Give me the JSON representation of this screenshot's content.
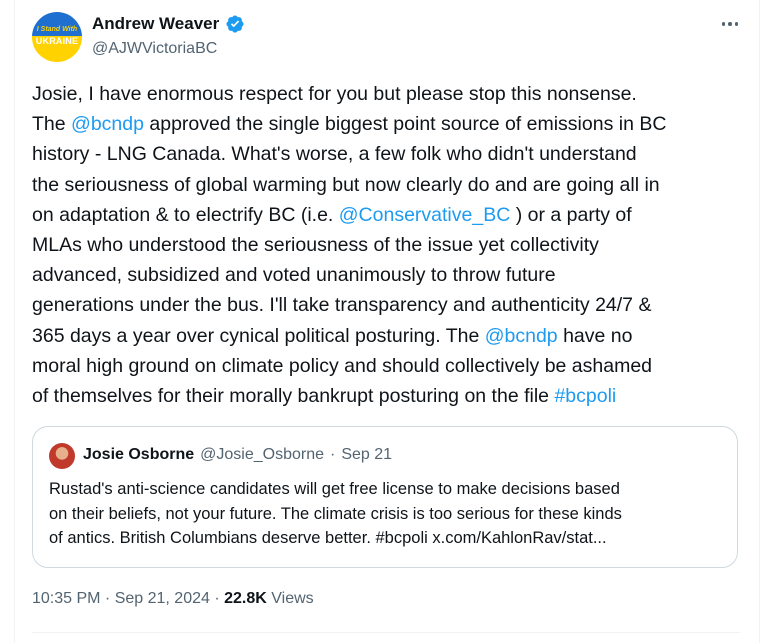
{
  "author": {
    "name": "Andrew Weaver",
    "handle": "@AJWVictoriaBC",
    "avatar_text_top": "I Stand With",
    "avatar_text_bottom": "UKRAINE",
    "verified_color": "#1d9bf0"
  },
  "tweet": {
    "lines": [
      [
        {
          "t": "Josie, I have enormous respect for you but please stop this nonsense."
        }
      ],
      [
        {
          "t": "The "
        },
        {
          "t": "@bcndp",
          "link": true
        },
        {
          "t": " approved the single biggest point source of emissions in BC"
        }
      ],
      [
        {
          "t": "history - LNG Canada. What's worse, a few folk who didn't understand"
        }
      ],
      [
        {
          "t": "the seriousness of global warming but now clearly do and are going all in"
        }
      ],
      [
        {
          "t": "on adaptation & to electrify BC (i.e. "
        },
        {
          "t": "@Conservative_BC",
          "link": true
        },
        {
          "t": " ) or a party of"
        }
      ],
      [
        {
          "t": "MLAs who understood the seriousness of the issue yet collectivity"
        }
      ],
      [
        {
          "t": "advanced, subsidized and voted unanimously to throw future"
        }
      ],
      [
        {
          "t": "generations under the bus. I'll take transparency and authenticity 24/7 &"
        }
      ],
      [
        {
          "t": "365 days a year over cynical political posturing. The "
        },
        {
          "t": "@bcndp",
          "link": true
        },
        {
          "t": " have no"
        }
      ],
      [
        {
          "t": "moral high ground on climate policy and should collectively be ashamed"
        }
      ],
      [
        {
          "t": "of themselves for their morally bankrupt posturing on the file "
        },
        {
          "t": "#bcpoli",
          "link": true
        }
      ]
    ]
  },
  "quote": {
    "name": "Josie Osborne",
    "handle": "@Josie_Osborne",
    "separator": "·",
    "date": "Sep 21",
    "lines": [
      "Rustad's anti-science candidates will get free license to make decisions based",
      "on their beliefs, not your future. The climate crisis is too serious for these kinds",
      "of antics. British Columbians deserve better. #bcpoli x.com/KahlonRav/stat..."
    ]
  },
  "meta": {
    "time": "10:35 PM",
    "separator": " · ",
    "date": "Sep 21, 2024",
    "views_count": "22.8K",
    "views_label": "Views"
  },
  "colors": {
    "link": "#1d9bf0",
    "muted": "#536471",
    "text": "#0f1419",
    "border": "#cfd9de"
  }
}
